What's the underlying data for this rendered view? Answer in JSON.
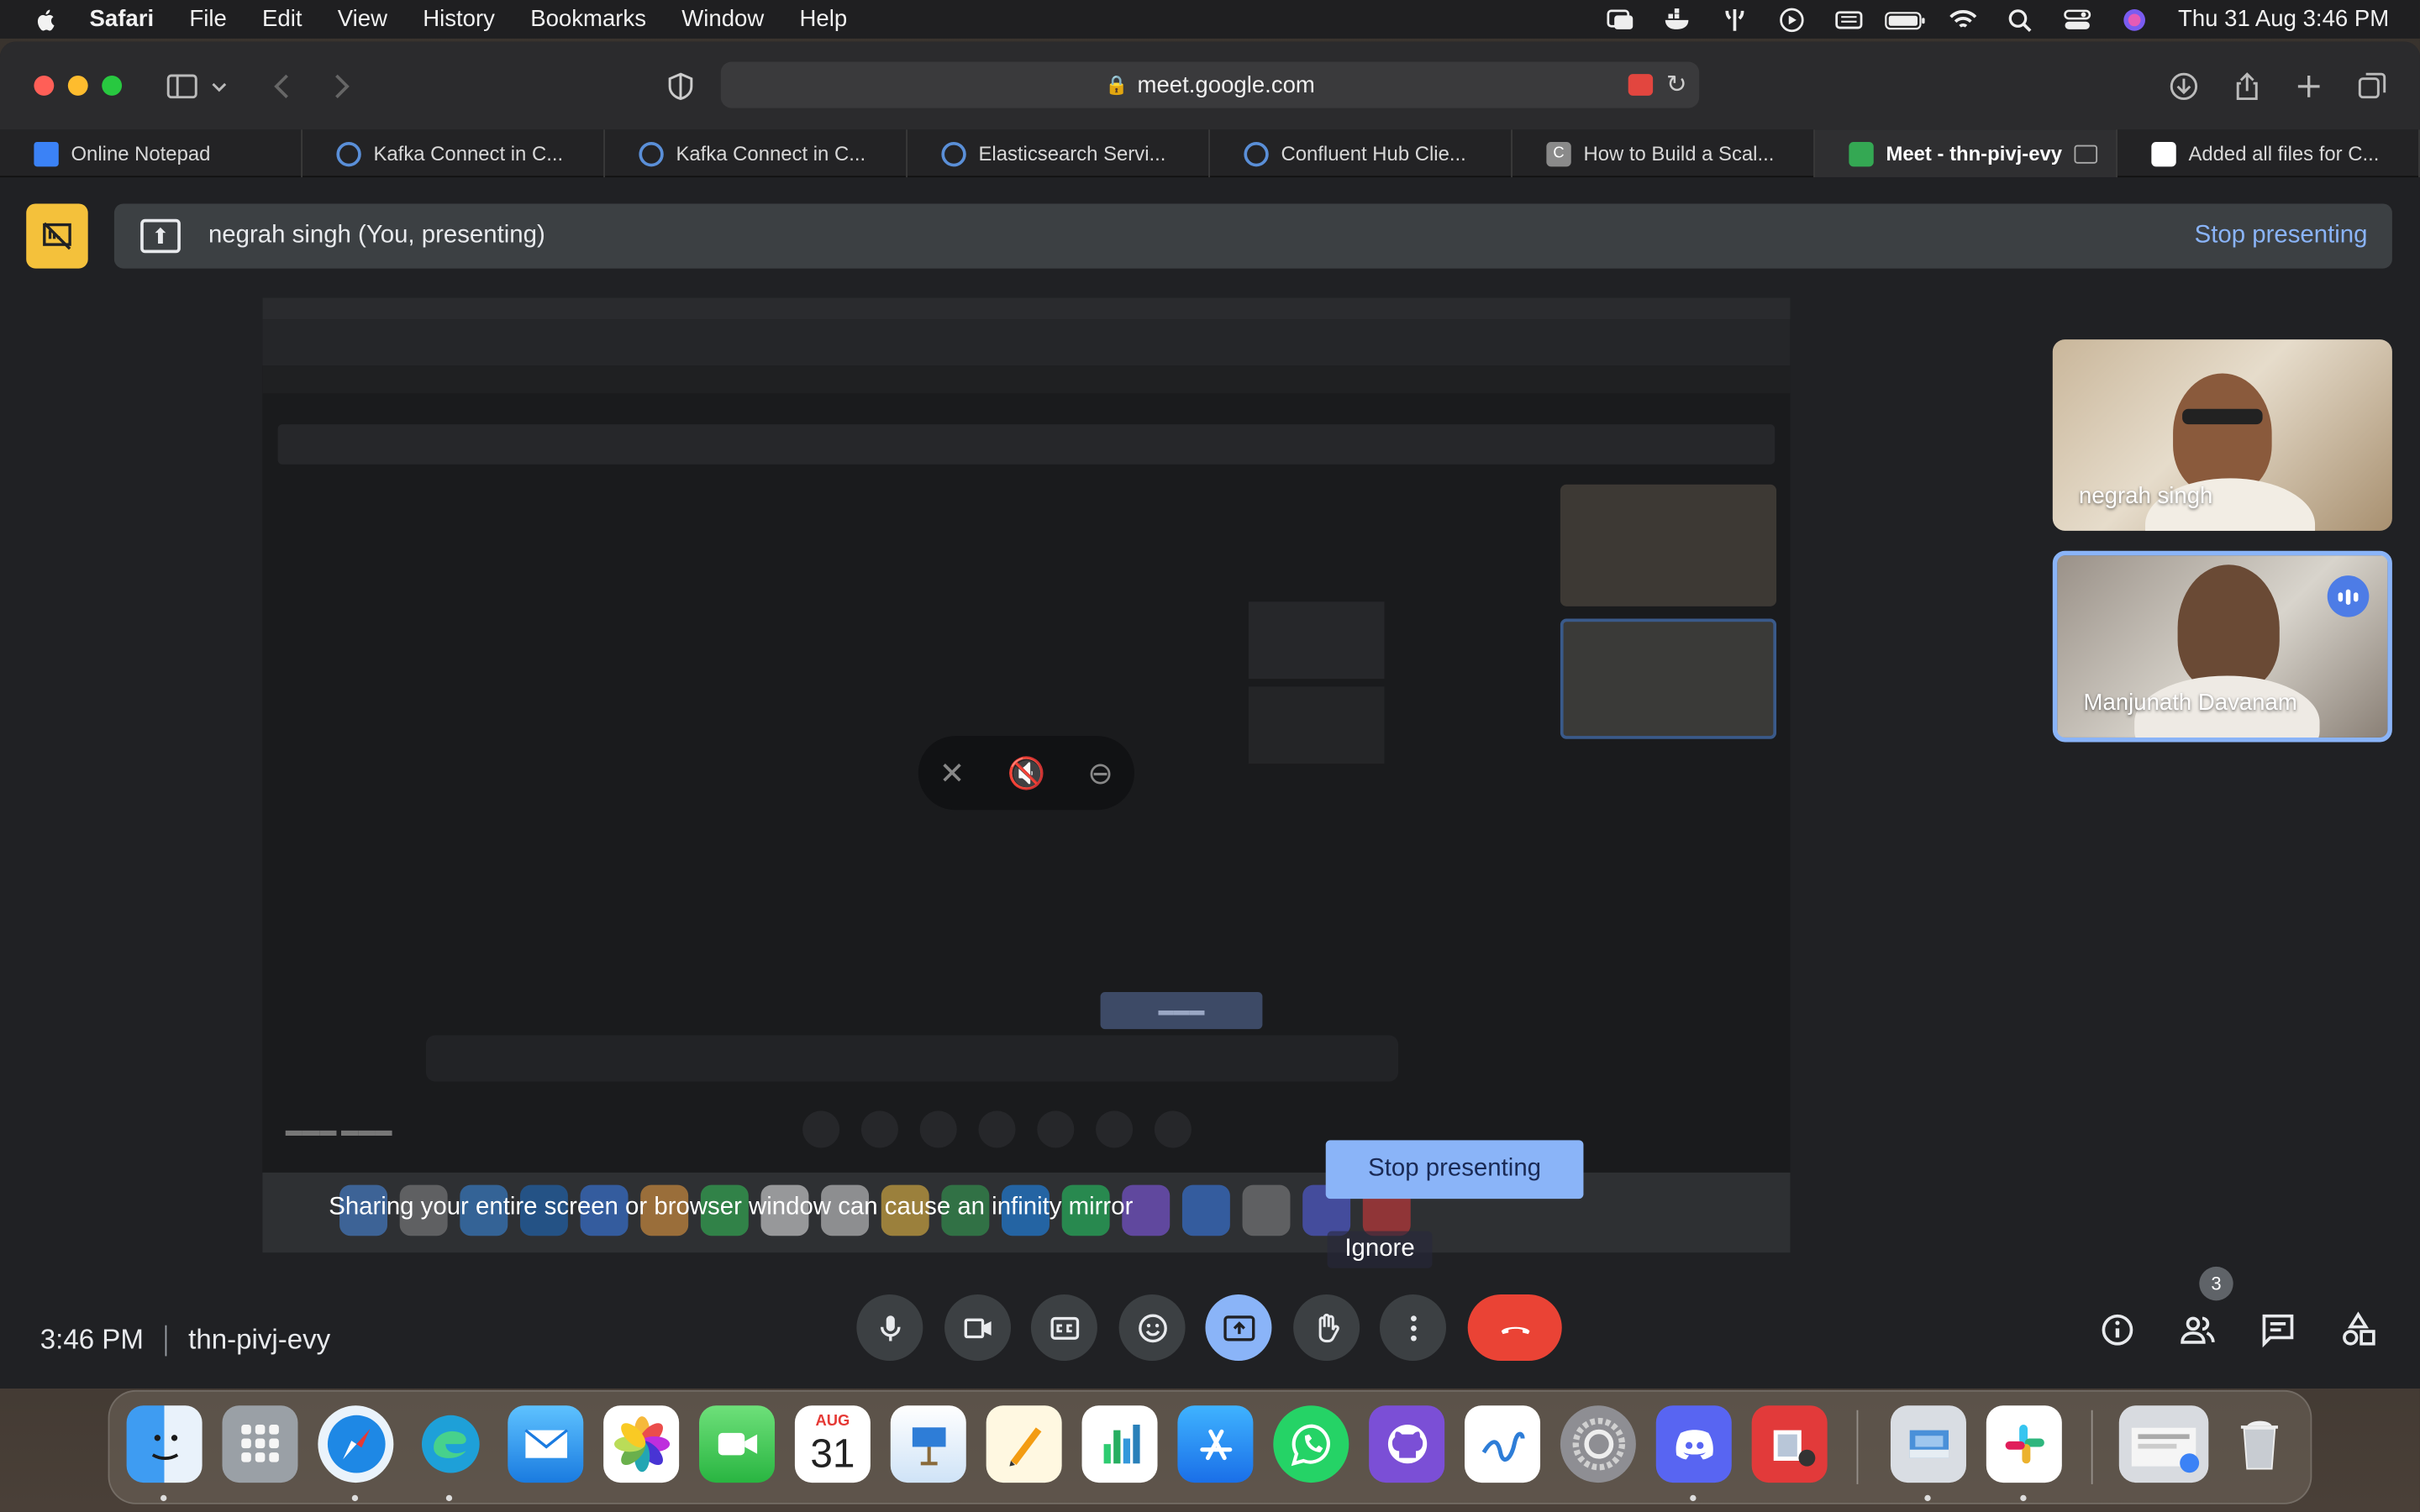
{
  "menubar": {
    "app": "Safari",
    "items": [
      "File",
      "Edit",
      "View",
      "History",
      "Bookmarks",
      "Window",
      "Help"
    ],
    "clock": "Thu 31 Aug  3:46 PM",
    "status_icons": [
      "screen-mirror-icon",
      "docker-icon",
      "airplay-icon",
      "play-icon",
      "keyboard-icon",
      "battery-icon",
      "wifi-icon",
      "search-icon",
      "control-center-icon",
      "siri-icon"
    ]
  },
  "browser": {
    "url": "meet.google.com",
    "tabs": [
      {
        "label": "Online Notepad",
        "icon": "notepad-icon",
        "color": "#3b82f6"
      },
      {
        "label": "Kafka Connect in C...",
        "icon": "confluent-icon",
        "color": "#2f6fd1"
      },
      {
        "label": "Kafka Connect in C...",
        "icon": "confluent-icon",
        "color": "#2f6fd1"
      },
      {
        "label": "Elasticsearch Servi...",
        "icon": "confluent-icon",
        "color": "#2f6fd1"
      },
      {
        "label": "Confluent Hub Clie...",
        "icon": "confluent-icon",
        "color": "#2f6fd1"
      },
      {
        "label": "How to Build a Scal...",
        "icon": "c-icon",
        "color": "#777777"
      },
      {
        "label": "Meet - thn-pivj-evy",
        "icon": "meet-icon",
        "color": "#34a853",
        "active": true
      },
      {
        "label": "Added all files for C...",
        "icon": "github-icon",
        "color": "#ffffff"
      }
    ]
  },
  "meet": {
    "presenting_label": "negrah singh (You, presenting)",
    "stop_presenting_link": "Stop presenting",
    "warning": "Sharing your entire screen or browser window can cause an infinity mirror",
    "stop_presenting_button": "Stop presenting",
    "ignore_button": "Ignore",
    "participants": [
      {
        "name": "negrah singh"
      },
      {
        "name": "Manjunath Davanam",
        "speaking": true
      }
    ],
    "time": "3:46 PM",
    "meeting_code": "thn-pivj-evy",
    "participant_count": "3"
  },
  "dock": {
    "date_month": "AUG",
    "date_day": "31"
  }
}
